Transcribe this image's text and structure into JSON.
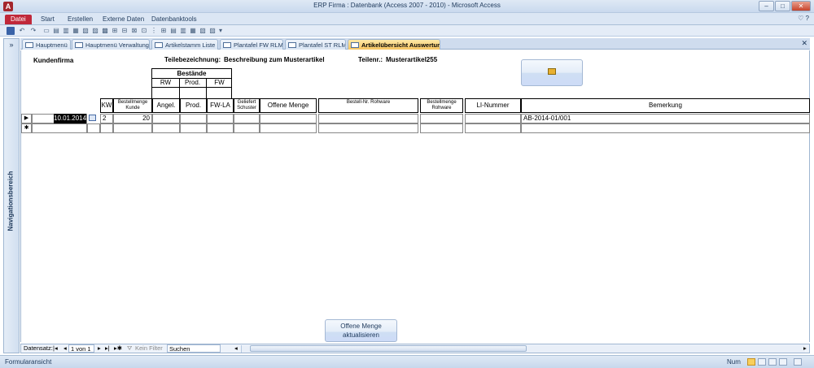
{
  "window": {
    "title": "ERP Firma : Datenbank (Access 2007 - 2010)  -  Microsoft Access",
    "app_icon": "A",
    "minimize": "–",
    "maximize": "□",
    "close": "✕"
  },
  "ribbon": {
    "tabs": [
      {
        "label": "Datei"
      },
      {
        "label": "Start"
      },
      {
        "label": "Erstellen"
      },
      {
        "label": "Externe Daten"
      },
      {
        "label": "Datenbanktools"
      }
    ],
    "help": "♡ ?"
  },
  "qat": {
    "undo": "↶",
    "redo": "↷",
    "more": "▾"
  },
  "nav": {
    "label": "Navigationsbereich",
    "toggle": "»"
  },
  "doc_tabs": [
    {
      "label": "Hauptmenü"
    },
    {
      "label": "Hauptmenü Verwaltung"
    },
    {
      "label": "Artikelstamm Liste"
    },
    {
      "label": "Plantafel FW RLM"
    },
    {
      "label": "Plantafel ST RLM"
    },
    {
      "label": "Artikelübersicht Auswertung"
    }
  ],
  "doc_close": "✕",
  "form": {
    "customer_label": "Kundenfirma",
    "part_desc_label": "Teilebezeichnung:",
    "part_desc_value": "Beschreibung zum Musterartikel",
    "part_no_label": "Teilenr.:",
    "part_no_value": "Musterartikel255",
    "stock_group": {
      "title": "Bestände",
      "subs": [
        "RW",
        "Prod.",
        "FW"
      ]
    },
    "columns": {
      "kw": "KW",
      "order_qty": "Bestellmenge Kunde",
      "angel": "Angel.",
      "prod": "Prod.",
      "fw_la": "FW-LA",
      "delivered": "Geliefert Schuster",
      "open_qty": "Offene Menge",
      "order_no_raw": "Bestell-Nr. Rohware",
      "order_qty_raw": "Bestellmenge Rohware",
      "li_no": "LI-Nummer",
      "remark": "Bemerkung"
    },
    "row": {
      "selector": "▶",
      "date": "10.01.2014",
      "kw": "2",
      "order_qty": "20",
      "remark": "AB-2014-01/001"
    },
    "new_row_selector": "✱",
    "update_button": "Offene Menge aktualisieren"
  },
  "record_nav": {
    "label": "Datensatz:",
    "first": "|◂",
    "prev": "◂",
    "position": "1 von 1",
    "next": "▸",
    "last": "▸|",
    "new": "▸✱",
    "filter": "Kein Filter",
    "search": "Suchen",
    "scroll_left": "◂",
    "scroll_right": "▸"
  },
  "status": {
    "left": "Formularansicht",
    "num": "Num"
  }
}
